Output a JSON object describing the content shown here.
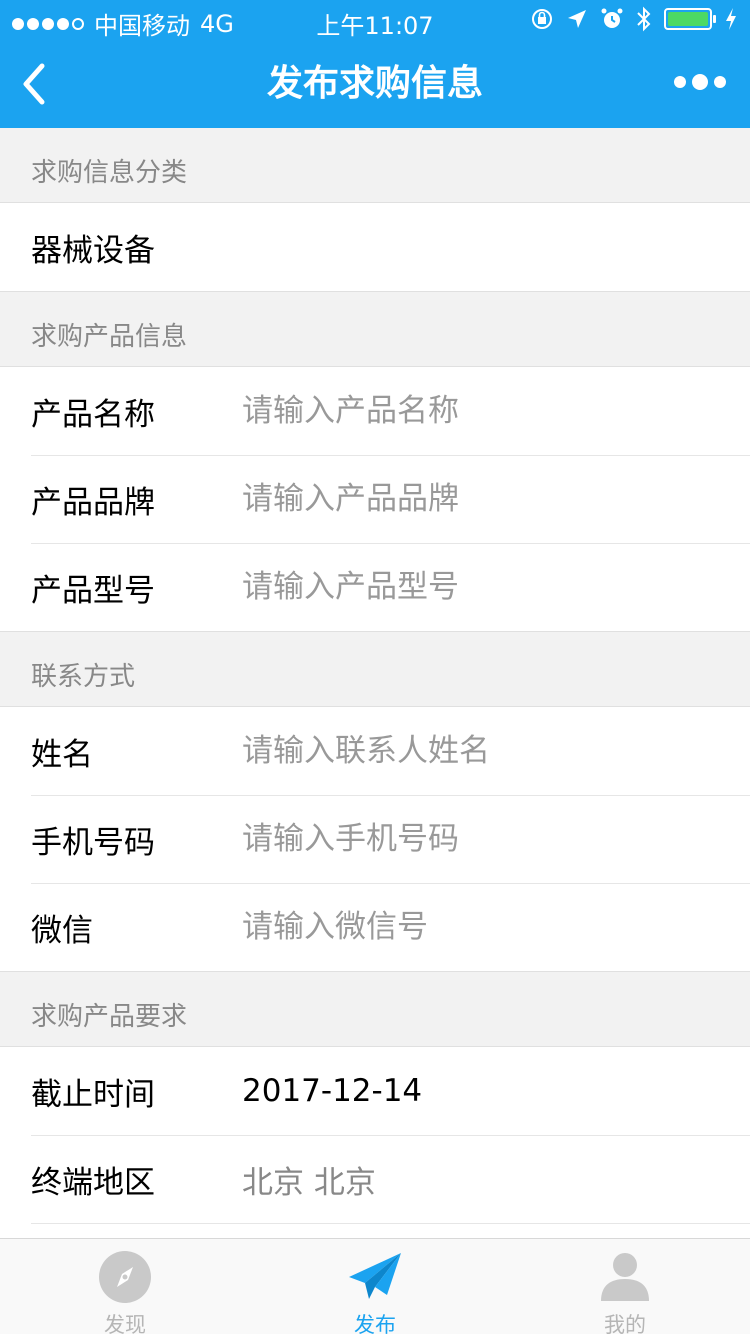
{
  "status_bar": {
    "carrier": "中国移动",
    "network": "4G",
    "time": "上午11:07"
  },
  "nav": {
    "title": "发布求购信息",
    "back_icon": "chevron-left-icon",
    "more_icon": "more-dots-icon"
  },
  "sections": [
    {
      "title": "求购信息分类",
      "rows": [
        {
          "value": "器械设备"
        }
      ]
    },
    {
      "title": "求购产品信息",
      "rows": [
        {
          "label": "产品名称",
          "placeholder": "请输入产品名称"
        },
        {
          "label": "产品品牌",
          "placeholder": "请输入产品品牌"
        },
        {
          "label": "产品型号",
          "placeholder": "请输入产品型号"
        }
      ]
    },
    {
      "title": "联系方式",
      "rows": [
        {
          "label": "姓名",
          "placeholder": "请输入联系人姓名"
        },
        {
          "label": "手机号码",
          "placeholder": "请输入手机号码"
        },
        {
          "label": "微信",
          "placeholder": "请输入微信号"
        }
      ]
    },
    {
      "title": "求购产品要求",
      "rows": [
        {
          "label": "截止时间",
          "value": "2017-12-14"
        },
        {
          "label": "终端地区",
          "value": "北京 北京"
        }
      ]
    }
  ],
  "tabbar": {
    "items": [
      {
        "label": "发现",
        "icon": "compass-icon"
      },
      {
        "label": "发布",
        "icon": "paper-plane-icon",
        "active": true
      },
      {
        "label": "我的",
        "icon": "person-icon"
      }
    ]
  },
  "colors": {
    "brand": "#1ba3f0",
    "battery": "#4cd964",
    "inactive_tab": "#b5b5b5"
  }
}
